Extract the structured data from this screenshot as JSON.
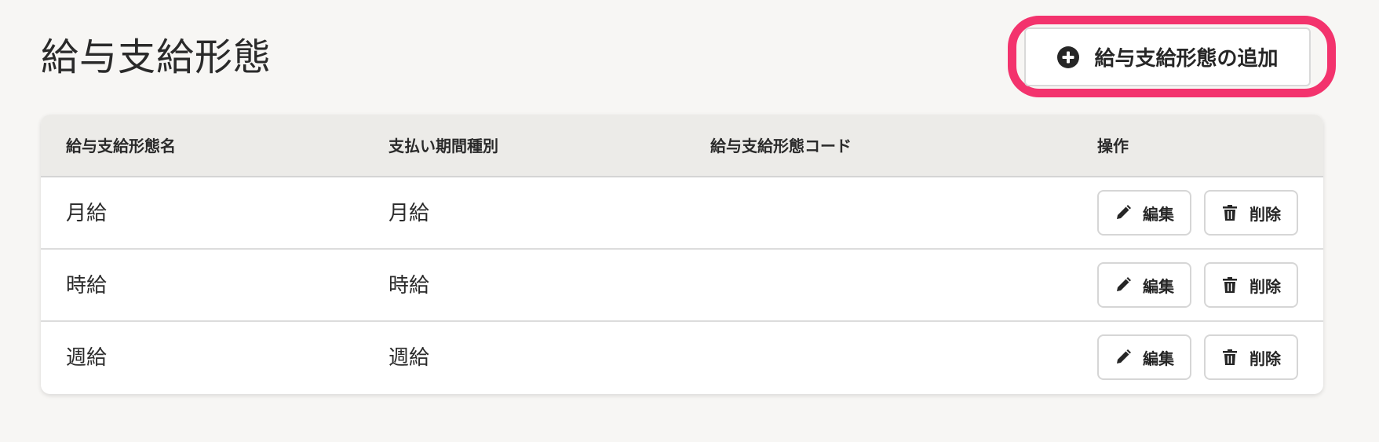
{
  "page": {
    "title": "給与支給形態"
  },
  "toolbar": {
    "add_label": "給与支給形態の追加",
    "add_icon": "plus-circle-icon",
    "highlight_color": "#f3336d"
  },
  "table": {
    "columns": [
      "給与支給形態名",
      "支払い期間種別",
      "給与支給形態コード",
      "操作"
    ],
    "rows": [
      {
        "name": "月給",
        "period": "月給",
        "code": ""
      },
      {
        "name": "時給",
        "period": "時給",
        "code": ""
      },
      {
        "name": "週給",
        "period": "週給",
        "code": ""
      }
    ],
    "actions": {
      "edit_label": "編集",
      "edit_icon": "pencil-icon",
      "delete_label": "削除",
      "delete_icon": "trash-icon"
    }
  }
}
